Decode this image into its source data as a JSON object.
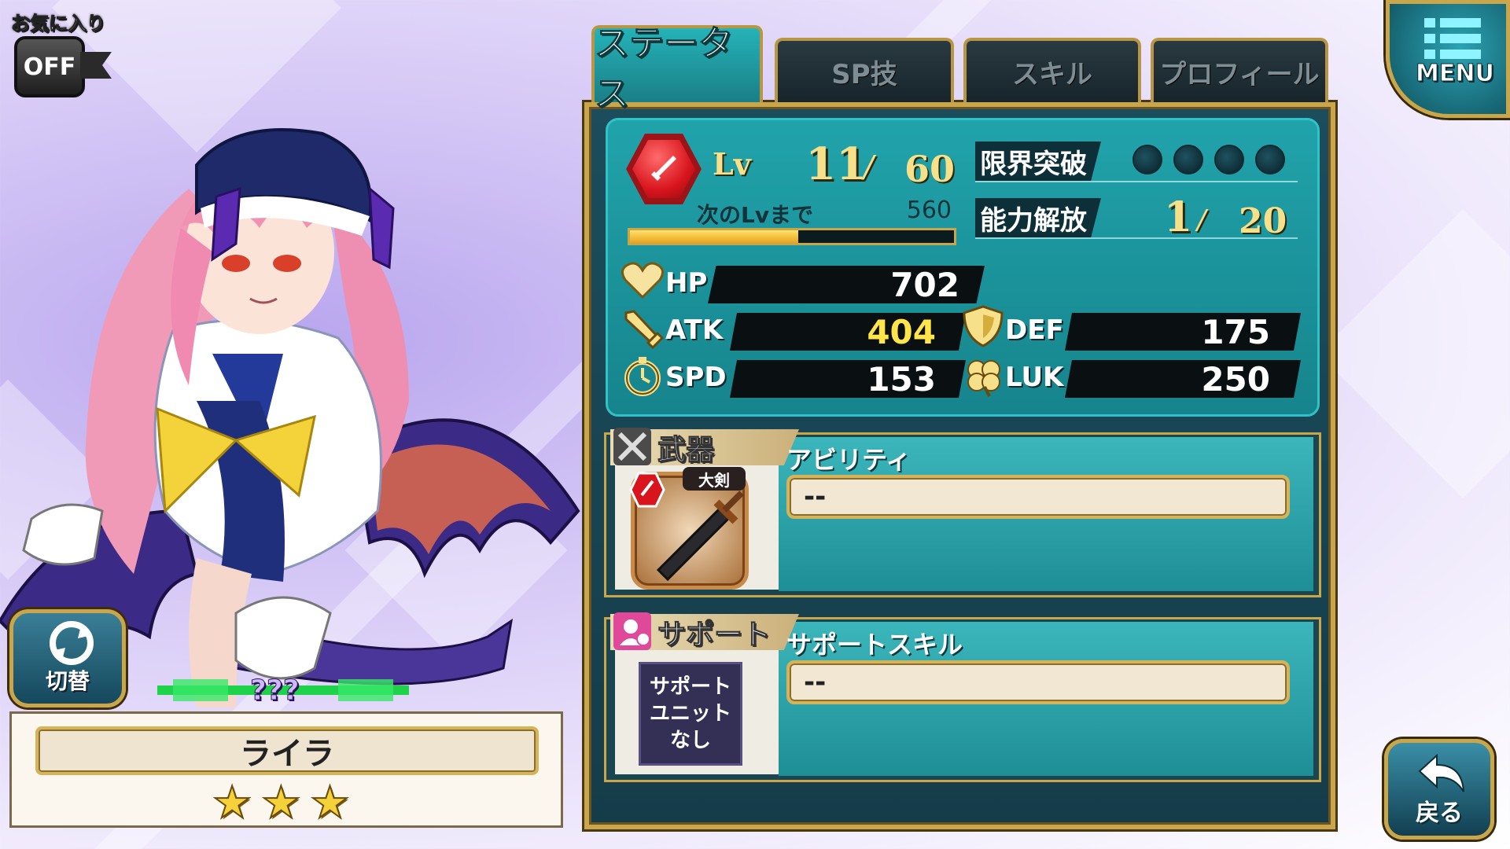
{
  "favorite": {
    "label": "お気に入り",
    "state": "OFF"
  },
  "switch_button": {
    "label": "切替"
  },
  "character": {
    "name": "ライラ",
    "rarity_label": "???",
    "stars": 3,
    "hair_color": "#f28db0",
    "accent_color": "#2b3c8f"
  },
  "tabs": [
    {
      "label": "ステータス",
      "active": true
    },
    {
      "label": "SP技",
      "active": false
    },
    {
      "label": "スキル",
      "active": false
    },
    {
      "label": "プロフィール",
      "active": false
    }
  ],
  "menu": {
    "label": "MENU"
  },
  "back": {
    "label": "戻る"
  },
  "level": {
    "label": "Lv",
    "current": "11",
    "max": "60",
    "next_label": "次のLvまで",
    "next_value": "560",
    "exp_progress": 0.52
  },
  "limit_break": {
    "label": "限界突破",
    "slots": 4,
    "filled": 0
  },
  "ability_release": {
    "label": "能力解放",
    "current": "1",
    "max": "20"
  },
  "stats": {
    "hp": {
      "label": "HP",
      "value": "702"
    },
    "atk": {
      "label": "ATK",
      "value": "404",
      "value_color": "#ffe44a"
    },
    "def": {
      "label": "DEF",
      "value": "175"
    },
    "spd": {
      "label": "SPD",
      "value": "153"
    },
    "luk": {
      "label": "LUK",
      "value": "250"
    }
  },
  "weapon": {
    "header": "武器",
    "type_tag": "大剣",
    "ability_title": "アビリティ",
    "ability_value": "--"
  },
  "support": {
    "header": "サポート",
    "unit_lines": [
      "サポート",
      "ユニット",
      "なし"
    ],
    "skill_title": "サポートスキル",
    "skill_value": "--"
  },
  "icons": [
    "heart-icon",
    "sword-icon",
    "shield-icon",
    "clock-icon",
    "clover-icon",
    "crossed-swords-icon",
    "support-icon",
    "menu-icon",
    "back-arrow-icon",
    "swap-icon",
    "red-gem-icon",
    "star-icon"
  ],
  "colors": {
    "panel": "#1c4d5c",
    "teal": "#21a3ab",
    "gold": "#c9a64a",
    "level_text": "#f6e08a"
  }
}
